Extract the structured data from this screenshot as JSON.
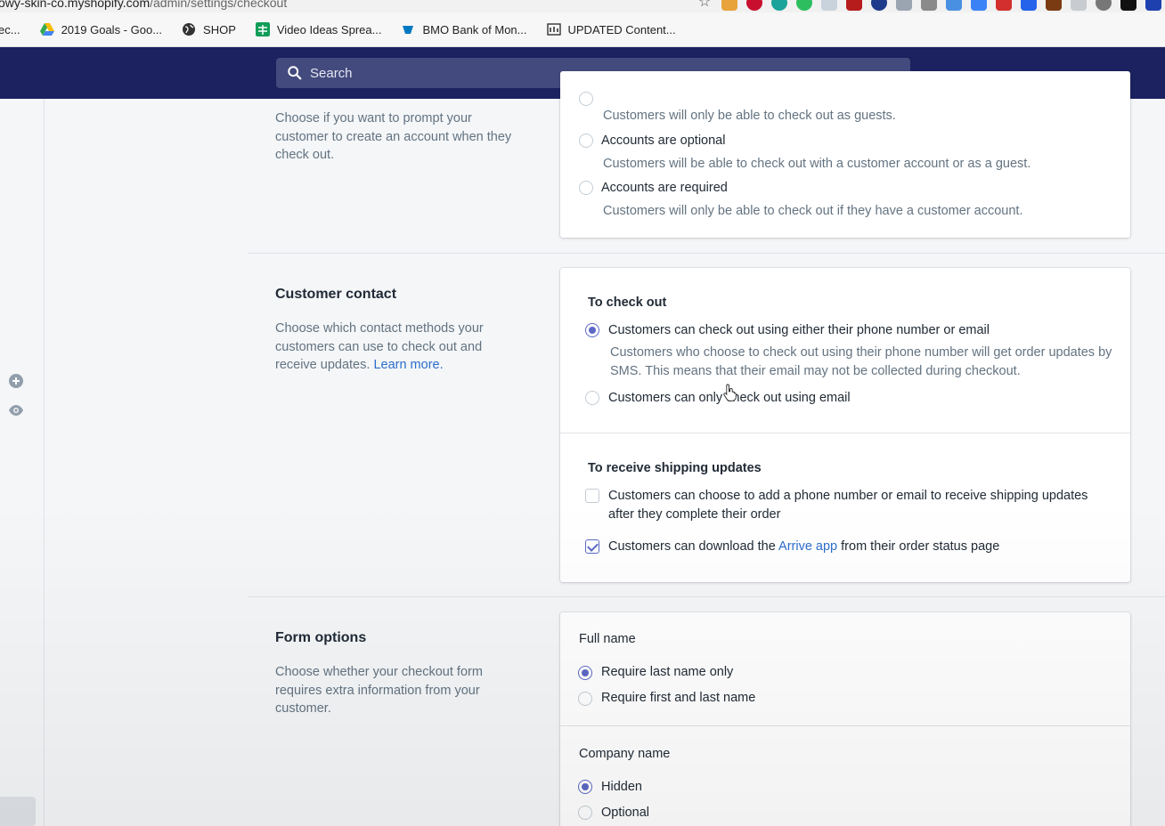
{
  "browser": {
    "url_host": "owy-skin-co.myshopify.com",
    "url_path": "/admin/settings/checkout",
    "bookmarks": [
      {
        "label": "ec...",
        "icon": "bookmark-icon"
      },
      {
        "label": "2019 Goals - Goo...",
        "icon": "google-drive-icon"
      },
      {
        "label": "SHOP",
        "icon": "globe-icon"
      },
      {
        "label": "Video Ideas Sprea...",
        "icon": "google-sheets-icon"
      },
      {
        "label": "BMO Bank of Mon...",
        "icon": "bmo-icon"
      },
      {
        "label": "UPDATED Content...",
        "icon": "document-icon"
      }
    ]
  },
  "topbar": {
    "search_placeholder": "Search"
  },
  "accounts_section": {
    "description": "Choose if you want to prompt your customer to create an account when they check out.",
    "options": [
      {
        "label": "",
        "help": "Customers will only be able to check out as guests.",
        "checked": false
      },
      {
        "label": "Accounts are optional",
        "help": "Customers will be able to check out with a customer account or as a guest.",
        "checked": false
      },
      {
        "label": "Accounts are required",
        "help": "Customers will only be able to check out if they have a customer account.",
        "checked": false
      }
    ]
  },
  "customer_contact": {
    "title": "Customer contact",
    "description": "Choose which contact methods your customers can use to check out and receive updates.",
    "learn_more": "Learn more.",
    "checkout_heading": "To check out",
    "checkout_options": [
      {
        "label": "Customers can check out using either their phone number or email",
        "help": "Customers who choose to check out using their phone number will get order updates by SMS. This means that their email may not be collected during checkout.",
        "checked": true
      },
      {
        "label": "Customers can only check out using email",
        "checked": false
      }
    ],
    "shipping_heading": "To receive shipping updates",
    "shipping_option_1": "Customers can choose to add a phone number or email to receive shipping updates after they complete their order",
    "shipping_option_2_pre": "Customers can download the ",
    "shipping_option_2_link": "Arrive app",
    "shipping_option_2_post": " from their order status page",
    "shipping_option_1_checked": false,
    "shipping_option_2_checked": true
  },
  "form_options": {
    "title": "Form options",
    "description": "Choose whether your checkout form requires extra information from your customer.",
    "full_name_heading": "Full name",
    "full_name_options": [
      {
        "label": "Require last name only",
        "checked": true
      },
      {
        "label": "Require first and last name",
        "checked": false
      }
    ],
    "company_heading": "Company name",
    "company_options": [
      {
        "label": "Hidden",
        "checked": true
      },
      {
        "label": "Optional",
        "checked": false
      }
    ]
  }
}
